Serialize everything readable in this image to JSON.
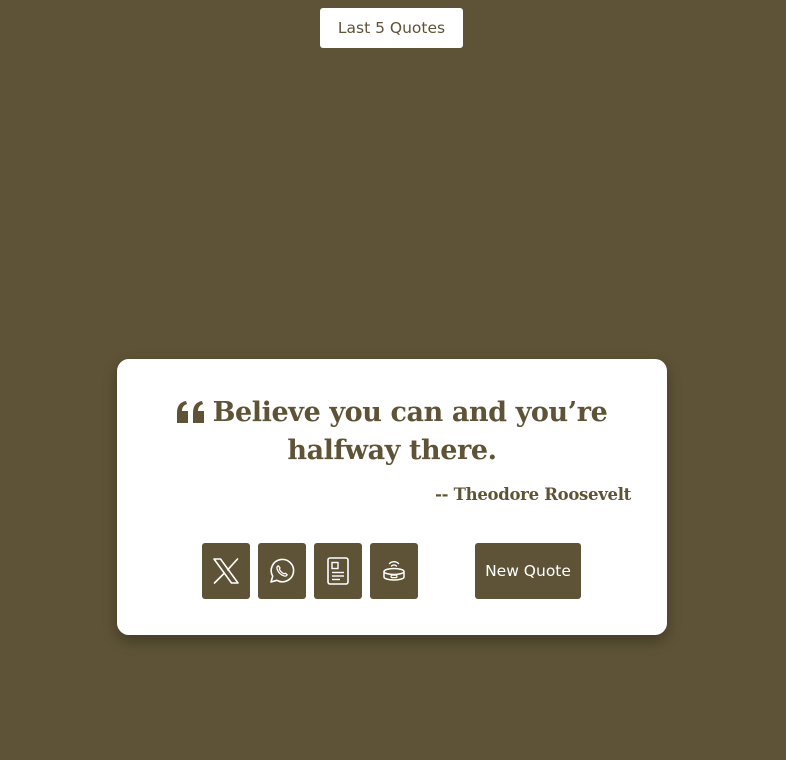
{
  "header": {
    "last_quotes_label": "Last 5 Quotes"
  },
  "quote": {
    "text": "Believe you can and you’re halfway there.",
    "author": "-- Theodore Roosevelt"
  },
  "share_buttons": [
    {
      "icon": "x-twitter-icon"
    },
    {
      "icon": "whatsapp-icon"
    },
    {
      "icon": "tumblr-document-icon"
    },
    {
      "icon": "speaker-icon"
    }
  ],
  "actions": {
    "new_quote_label": "New Quote"
  },
  "colors": {
    "background": "#5e5336",
    "card": "#ffffff",
    "accent": "#5e5336"
  }
}
